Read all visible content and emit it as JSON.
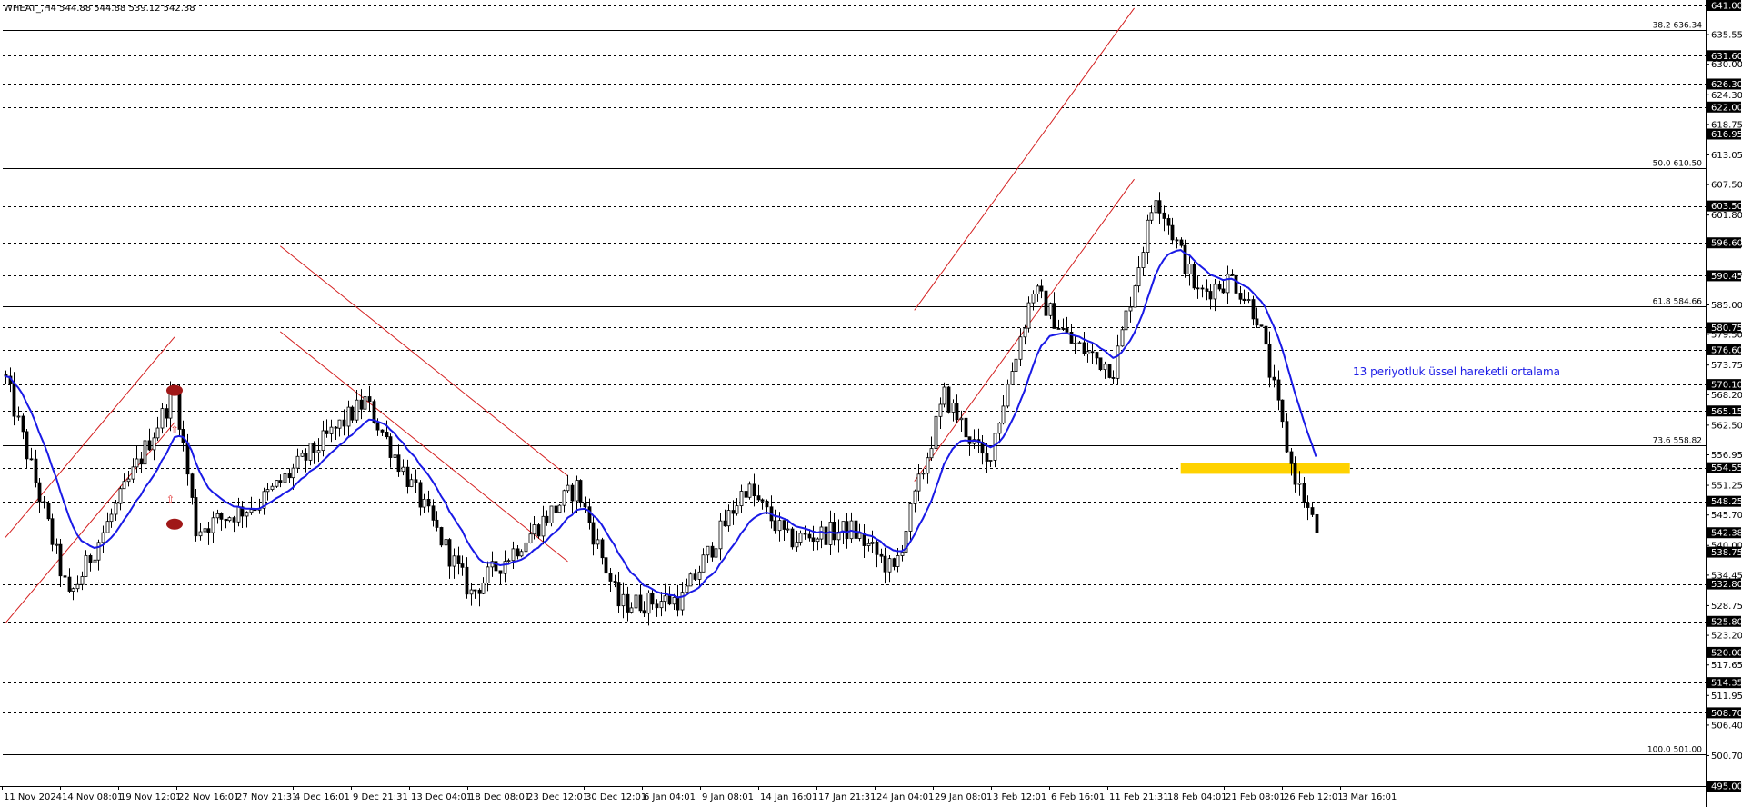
{
  "chart_data": {
    "type": "candlestick",
    "symbol_info": "WHEAT_,H4  544.88 544.88 539.12 542.38",
    "y_range": [
      495.0,
      641.0
    ],
    "y_ticks": [
      "641.00",
      "635.55",
      "630.00",
      "624.30",
      "618.75",
      "613.05",
      "607.50",
      "601.80",
      "596.25",
      "590.70",
      "585.00",
      "579.50",
      "573.75",
      "568.20",
      "562.50",
      "556.95",
      "551.25",
      "545.70",
      "540.00",
      "534.45",
      "528.75",
      "523.20",
      "517.65",
      "511.95",
      "506.40",
      "500.70",
      "495.00"
    ],
    "x_labels": [
      "11 Nov 2024",
      "14 Nov 08:01",
      "19 Nov 12:01",
      "22 Nov 16:01",
      "27 Nov 21:31",
      "4 Dec 16:01",
      "9 Dec 21:31",
      "13 Dec 04:01",
      "18 Dec 08:01",
      "23 Dec 12:01",
      "30 Dec 12:01",
      "6 Jan 04:01",
      "9 Jan 08:01",
      "14 Jan 16:01",
      "17 Jan 21:31",
      "24 Jan 04:01",
      "29 Jan 08:01",
      "3 Feb 12:01",
      "6 Feb 16:01",
      "11 Feb 21:31",
      "18 Feb 04:01",
      "21 Feb 08:01",
      "26 Feb 12:01",
      "3 Mar 16:01"
    ],
    "horizontal_levels": [
      641.0,
      631.6,
      626.3,
      622.0,
      616.95,
      603.5,
      596.6,
      590.45,
      580.75,
      576.6,
      570.1,
      565.15,
      554.55,
      548.25,
      538.75,
      532.8,
      525.8,
      520.0,
      514.35,
      508.7,
      495.0
    ],
    "fib_levels": [
      {
        "label": "38.2 636.34",
        "value": 636.34
      },
      {
        "label": "50.0 610.50",
        "value": 610.5
      },
      {
        "label": "61.8 584.66",
        "value": 584.66
      },
      {
        "label": "73.6 558.82",
        "value": 558.82
      },
      {
        "label": "100.0 501.00",
        "value": 501.0
      }
    ],
    "current_price": 542.38,
    "current_price_label": "542.38",
    "indicator_label": "13 periyotluk üssel hareketli ortalama",
    "colors": {
      "candle": "#000000",
      "ema": "#1a1ae6",
      "channel": "#d42020",
      "level_line": "#000000",
      "fib_line": "#000000",
      "highlight_zone": "#ffd200",
      "pivot_marker": "#a01818",
      "price_tag_bg": "#000000",
      "price_tag_text": "#ffffff"
    },
    "anchors": [
      {
        "bar": 0,
        "price": 571
      },
      {
        "bar": 15,
        "price": 530
      },
      {
        "bar": 40,
        "price": 569
      },
      {
        "bar": 45,
        "price": 543
      },
      {
        "bar": 60,
        "price": 548
      },
      {
        "bar": 85,
        "price": 567
      },
      {
        "bar": 110,
        "price": 531
      },
      {
        "bar": 135,
        "price": 551
      },
      {
        "bar": 145,
        "price": 529
      },
      {
        "bar": 160,
        "price": 530
      },
      {
        "bar": 175,
        "price": 551
      },
      {
        "bar": 185,
        "price": 541
      },
      {
        "bar": 200,
        "price": 543
      },
      {
        "bar": 210,
        "price": 535
      },
      {
        "bar": 222,
        "price": 568
      },
      {
        "bar": 232,
        "price": 555
      },
      {
        "bar": 243,
        "price": 588
      },
      {
        "bar": 252,
        "price": 578
      },
      {
        "bar": 262,
        "price": 573
      },
      {
        "bar": 272,
        "price": 606
      },
      {
        "bar": 282,
        "price": 587
      },
      {
        "bar": 290,
        "price": 590
      },
      {
        "bar": 296,
        "price": 583
      },
      {
        "bar": 304,
        "price": 555
      },
      {
        "bar": 310,
        "price": 542.38
      }
    ],
    "channels": [
      {
        "a": [
          0,
          525.5
        ],
        "b": [
          40,
          563
        ],
        "offset": 16
      },
      {
        "a": [
          65,
          596
        ],
        "b": [
          133,
          553
        ],
        "offset": -16
      },
      {
        "a": [
          215,
          552
        ],
        "b": [
          267,
          608.5
        ],
        "offset": 32
      }
    ],
    "highlight_zone": {
      "from_bar": 278,
      "to_bar": 318,
      "low": 553.4,
      "high": 555.5
    },
    "pivot_markers": [
      {
        "bar": 40,
        "price": 569
      },
      {
        "bar": 40,
        "price": 544
      }
    ],
    "arrow_markers": [
      {
        "bar": 40,
        "price": 561
      },
      {
        "bar": 39,
        "price": 548
      }
    ]
  }
}
